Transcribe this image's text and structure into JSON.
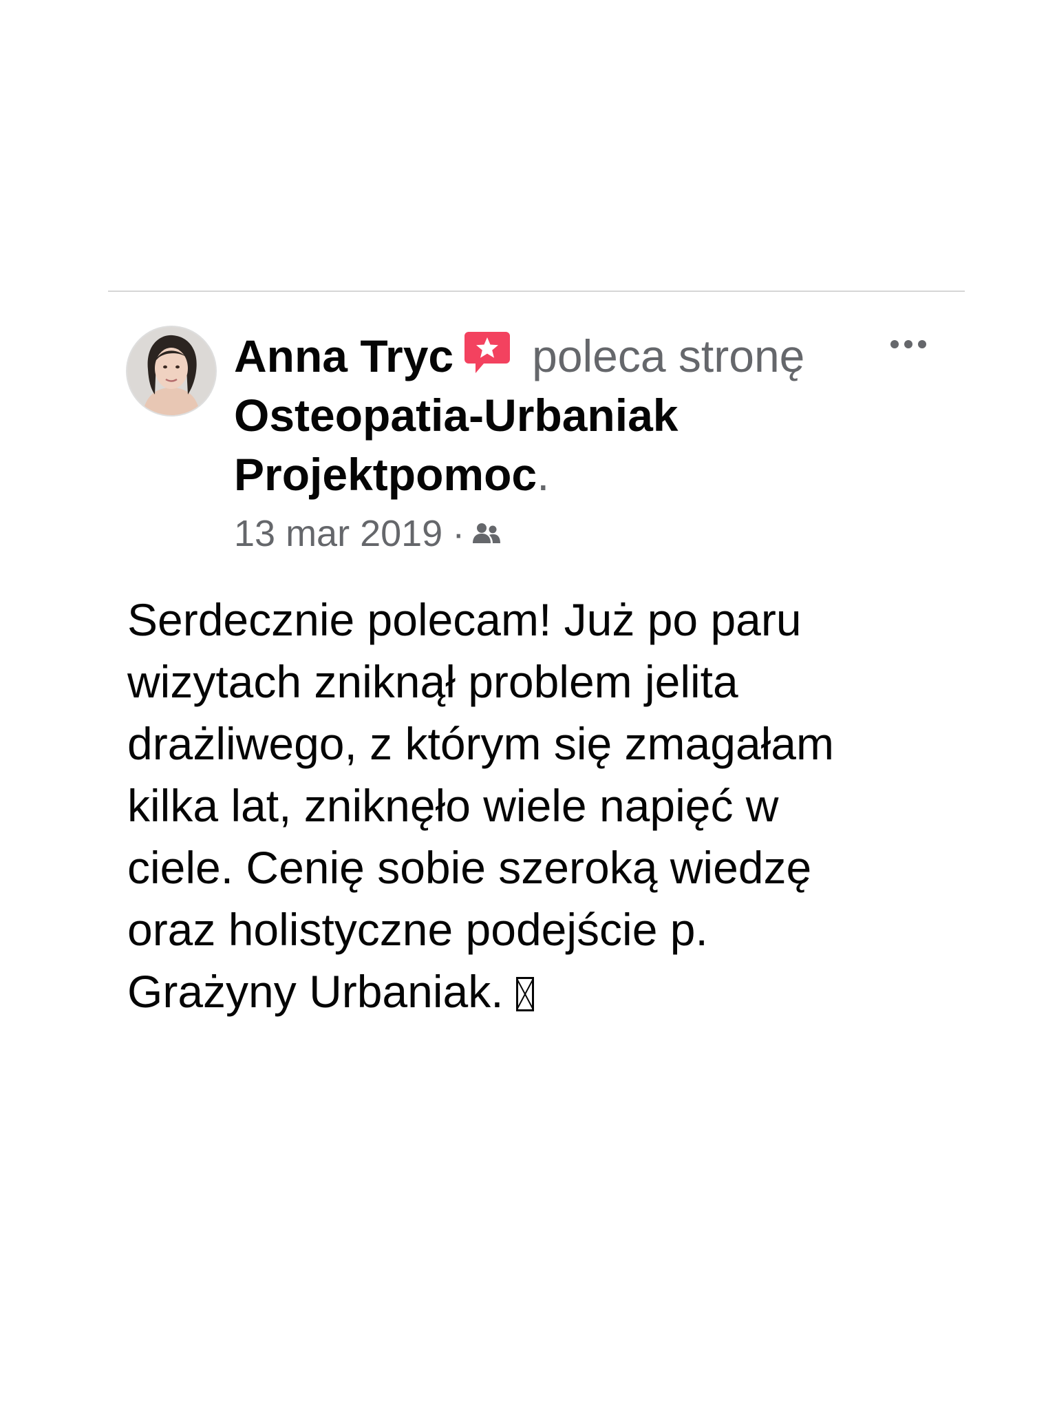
{
  "post": {
    "author": "Anna Tryc",
    "action": "poleca stronę",
    "page_name": "Osteopatia-Urbaniak Projektpomoc",
    "page_suffix": ".",
    "date": "13 mar 2019",
    "separator": "·",
    "audience_icon": "friends-icon",
    "recommend_icon": "recommendation-star-icon",
    "more_icon": "more-options-icon",
    "body_lines": [
      "Serdecznie polecam! Już po paru",
      "wizytach zniknął problem jelita",
      "drażliwego, z którym się zmagałam",
      "kilka lat, zniknęło wiele napięć w",
      "ciele. Cenię sobie szeroką wiedzę",
      "oraz holistyczne podejście p.",
      "Grażyny Urbaniak."
    ]
  },
  "colors": {
    "recommend_icon": "#f3425f",
    "secondary_text": "#65676b",
    "primary_text": "#050505",
    "divider": "#d6d6d6"
  }
}
